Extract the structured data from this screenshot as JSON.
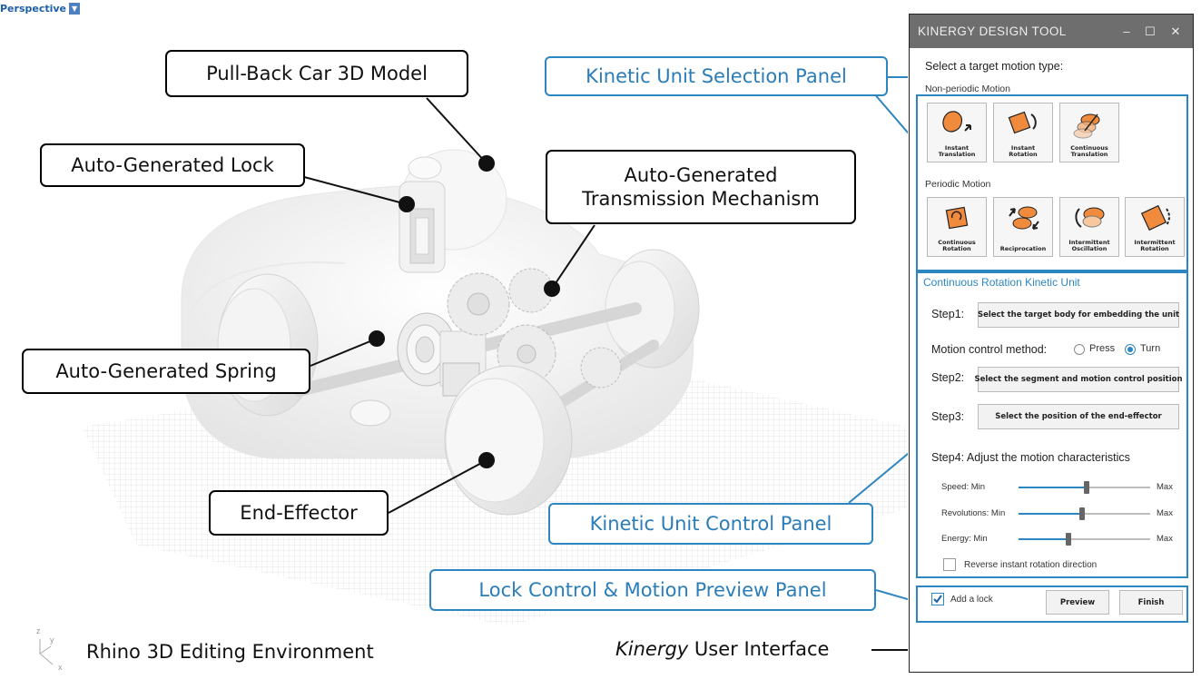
{
  "viewport": {
    "tab_label": "Perspective",
    "env_label": "Rhino 3D Editing Environment",
    "axis_labels": [
      "z",
      "y",
      "x"
    ]
  },
  "callouts": {
    "car_model": "Pull-Back Car 3D Model",
    "lock": "Auto-Generated Lock",
    "transmission_line1": "Auto-Generated",
    "transmission_line2": "Transmission Mechanism",
    "spring": "Auto-Generated Spring",
    "end_effector": "End-Effector"
  },
  "panel_callouts": {
    "selection": "Kinetic Unit Selection Panel",
    "control": "Kinetic Unit Control Panel",
    "lock_preview": "Lock Control & Motion Preview Panel"
  },
  "interface_label": {
    "italic": "Kinergy",
    "rest": " User Interface"
  },
  "tool": {
    "title": "KINERGY DESIGN TOOL",
    "window_buttons": {
      "minimize": "–",
      "maximize": "☐",
      "close": "✕"
    },
    "select_prompt": "Select a target motion type:",
    "non_periodic_label": "Non-periodic Motion",
    "non_periodic": [
      {
        "label1": "Instant",
        "label2": "Translation",
        "icon": "instant-translation-icon"
      },
      {
        "label1": "Instant",
        "label2": "Rotation",
        "icon": "instant-rotation-icon"
      },
      {
        "label1": "Continuous",
        "label2": "Translation",
        "icon": "continuous-translation-icon"
      }
    ],
    "periodic_label": "Periodic Motion",
    "periodic": [
      {
        "label1": "Continuous",
        "label2": "Rotation",
        "icon": "continuous-rotation-icon"
      },
      {
        "label1": "Reciprocation",
        "label2": "",
        "icon": "reciprocation-icon"
      },
      {
        "label1": "Intermittent",
        "label2": "Oscillation",
        "icon": "intermittent-oscillation-icon"
      },
      {
        "label1": "Intermittent",
        "label2": "Rotation",
        "icon": "intermittent-rotation-icon"
      }
    ],
    "unit_title": "Continuous Rotation Kinetic Unit",
    "step1_label": "Step1:",
    "step1_button": "Select the target body  for embedding the unit",
    "motion_control_label": "Motion control method:",
    "radio_press": "Press",
    "radio_turn": "Turn",
    "selected_method": "Turn",
    "step2_label": "Step2:",
    "step2_button": "Select the segment and motion control position",
    "step3_label": "Step3:",
    "step3_button": "Select the position of the end-effector",
    "step4_label": "Step4:  Adjust the motion characteristics",
    "sliders": [
      {
        "label": "Speed: Min",
        "max": "Max",
        "value": 0.52
      },
      {
        "label": "Revolutions: Min",
        "max": "Max",
        "value": 0.48
      },
      {
        "label": "Energy: Min",
        "max": "Max",
        "value": 0.38
      }
    ],
    "reverse_label": "Reverse instant rotation direction",
    "reverse_checked": false,
    "add_lock_label": "Add a lock",
    "add_lock_checked": true,
    "preview_button": "Preview",
    "finish_button": "Finish",
    "accent_color": "#2e86c1",
    "tile_orange": "#f08a3c"
  }
}
